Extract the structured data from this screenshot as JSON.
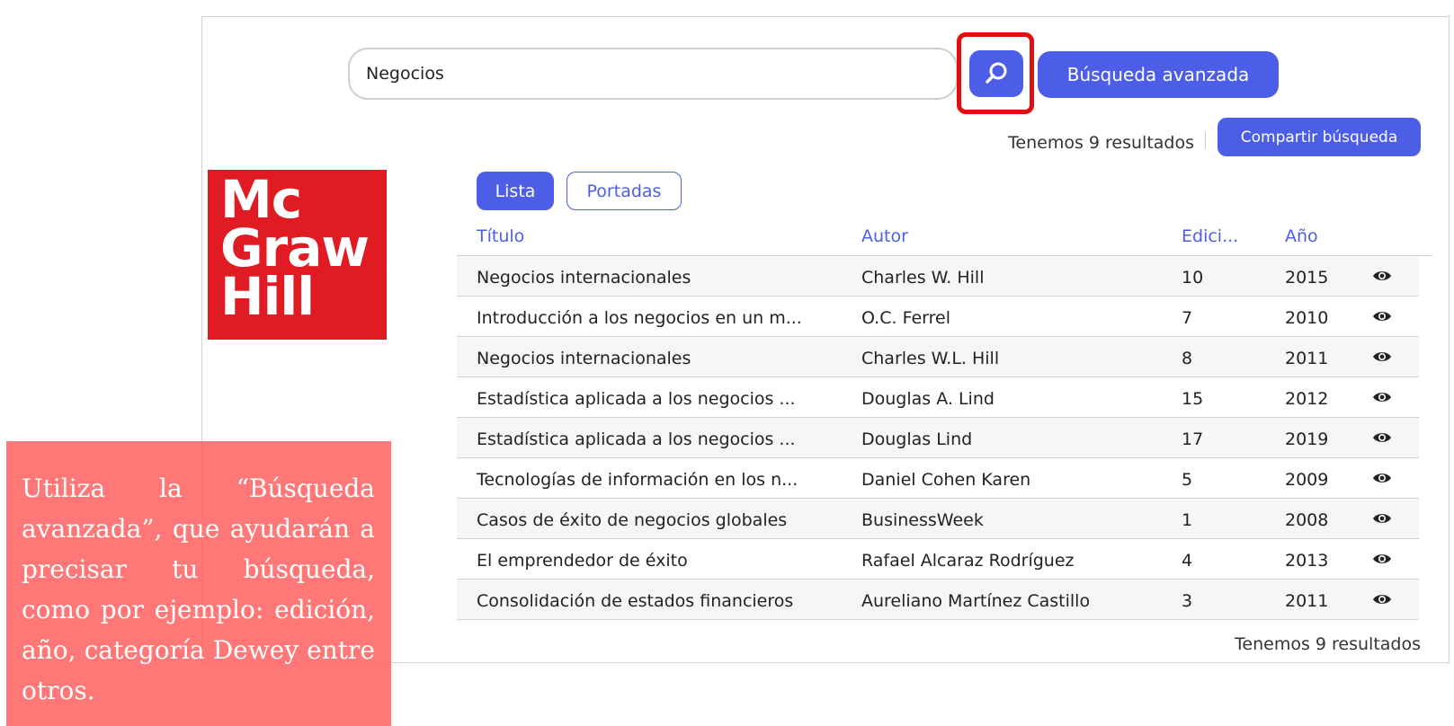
{
  "search": {
    "value": "Negocios"
  },
  "buttons": {
    "advanced_search": "Búsqueda avanzada",
    "share_search": "Compartir búsqueda"
  },
  "results_summary_top": "Tenemos 9 resultados",
  "results_summary_bottom": "Tenemos 9 resultados",
  "logo_text": [
    "Mc",
    "Graw",
    "Hill"
  ],
  "tabs": [
    {
      "label": "Lista",
      "active": true
    },
    {
      "label": "Portadas",
      "active": false
    }
  ],
  "table": {
    "headers": {
      "title": "Título",
      "author": "Autor",
      "edition": "Edici...",
      "year": "Año"
    },
    "rows": [
      {
        "title": "Negocios internacionales",
        "author": "Charles W. Hill",
        "edition": "10",
        "year": "2015"
      },
      {
        "title": "Introducción a los negocios en un m...",
        "author": "O.C. Ferrel",
        "edition": "7",
        "year": "2010"
      },
      {
        "title": "Negocios internacionales",
        "author": "Charles W.L. Hill",
        "edition": "8",
        "year": "2011"
      },
      {
        "title": "Estadística aplicada a los negocios ...",
        "author": "Douglas A. Lind",
        "edition": "15",
        "year": "2012"
      },
      {
        "title": "Estadística aplicada a los negocios ...",
        "author": "Douglas Lind",
        "edition": "17",
        "year": "2019"
      },
      {
        "title": "Tecnologías de información en los n...",
        "author": "Daniel Cohen Karen",
        "edition": "5",
        "year": "2009"
      },
      {
        "title": "Casos de éxito de negocios globales",
        "author": "BusinessWeek",
        "edition": "1",
        "year": "2008"
      },
      {
        "title": "El emprendedor de éxito",
        "author": "Rafael Alcaraz Rodríguez",
        "edition": "4",
        "year": "2013"
      },
      {
        "title": "Consolidación de estados financieros",
        "author": "Aureliano Martínez Castillo",
        "edition": "3",
        "year": "2011"
      }
    ]
  },
  "note": "Utiliza la “Búsqueda avanzada”, que ayudarán a precisar tu búsqueda, como por ejemplo: edición, año, categoría Dewey entre otros.",
  "colors": {
    "accent": "#4c5ee6",
    "highlight": "#e01010",
    "logo_red": "#e01b24",
    "note_bg": "#ff5f5f"
  },
  "icons": {
    "search": "search-icon",
    "view": "eye-icon"
  }
}
